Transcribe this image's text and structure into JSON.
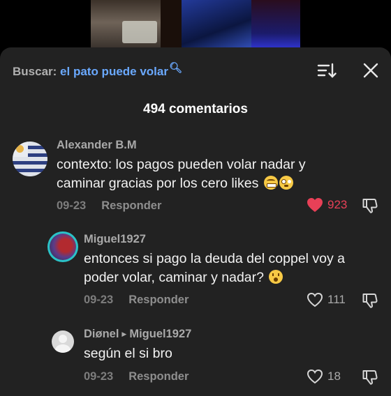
{
  "search": {
    "prefix": "Buscar:",
    "query": "el pato puede volar"
  },
  "header": {
    "count_label": "494 comentarios"
  },
  "comments": [
    {
      "author": "Alexander B.M",
      "text": "contexto: los pagos pueden volar nadar y caminar gracias por los cero likes",
      "date": "09-23",
      "reply_label": "Responder",
      "likes": "923",
      "liked": true
    },
    {
      "author": "Miguel1927",
      "text": "entonces si pago la deuda del coppel voy a poder volar, caminar y nadar?",
      "date": "09-23",
      "reply_label": "Responder",
      "likes": "111",
      "liked": false
    },
    {
      "author": "Diønel",
      "reply_to": "Miguel1927",
      "text": "según el si bro",
      "date": "09-23",
      "reply_label": "Responder",
      "likes": "18",
      "liked": false
    }
  ],
  "colors": {
    "accent_link": "#6aa9ff",
    "like_active": "#e84057",
    "sheet_bg": "#222222"
  }
}
